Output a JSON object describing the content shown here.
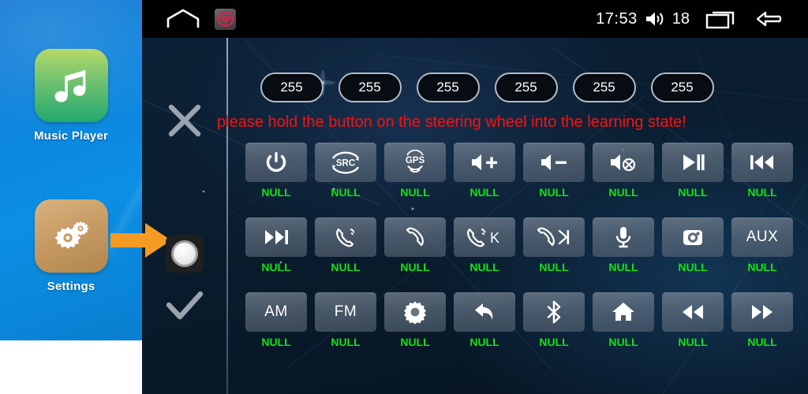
{
  "launcher": {
    "apps": [
      {
        "label": "Music Player",
        "icon": "music-note-icon"
      },
      {
        "label": "Settings",
        "icon": "gears-icon"
      }
    ],
    "pointer_icon": "orange-right-arrow-icon"
  },
  "statusbar": {
    "home_icon": "home-outline-icon",
    "steering_app_icon": "steering-wheel-icon",
    "time": "17:53",
    "volume_icon": "volume-speaker-icon",
    "volume_level": "18",
    "recents_icon": "recent-apps-icon",
    "back_icon": "back-arrow-icon"
  },
  "controls": {
    "cancel_icon": "close-x-icon",
    "knob_icon": "steering-knob-icon",
    "confirm_icon": "checkmark-icon"
  },
  "value_pills": [
    "255",
    "255",
    "255",
    "255",
    "255",
    "255"
  ],
  "warning": {
    "message": "please hold the button on the steering wheel into the learning state!",
    "color": "#f21414"
  },
  "grid": {
    "null_label": "NULL",
    "null_color": "#17e017",
    "buttons": [
      {
        "icon": "power-icon",
        "glyph": "",
        "status": "NULL"
      },
      {
        "icon": "src-source-icon",
        "glyph": "SRC",
        "status": "NULL"
      },
      {
        "icon": "gps-icon",
        "glyph": "GPS",
        "status": "NULL"
      },
      {
        "icon": "volume-up-icon",
        "glyph": "",
        "status": "NULL"
      },
      {
        "icon": "volume-down-icon",
        "glyph": "",
        "status": "NULL"
      },
      {
        "icon": "volume-mute-icon",
        "glyph": "",
        "status": "NULL"
      },
      {
        "icon": "play-pause-icon",
        "glyph": "",
        "status": "NULL"
      },
      {
        "icon": "previous-track-icon",
        "glyph": "",
        "status": "NULL"
      },
      {
        "icon": "next-track-icon",
        "glyph": "",
        "status": "NULL"
      },
      {
        "icon": "call-answer-icon",
        "glyph": "",
        "status": "NULL"
      },
      {
        "icon": "call-hangup-icon",
        "glyph": "",
        "status": "NULL"
      },
      {
        "icon": "call-answer-k-icon",
        "glyph": "K",
        "status": "NULL"
      },
      {
        "icon": "call-hangup-skip-icon",
        "glyph": "",
        "status": "NULL"
      },
      {
        "icon": "microphone-icon",
        "glyph": "",
        "status": "NULL"
      },
      {
        "icon": "camera-icon",
        "glyph": "",
        "status": "NULL"
      },
      {
        "icon": "aux-icon",
        "glyph": "AUX",
        "status": "NULL"
      },
      {
        "icon": "am-radio-icon",
        "glyph": "AM",
        "status": "NULL"
      },
      {
        "icon": "fm-radio-icon",
        "glyph": "FM",
        "status": "NULL"
      },
      {
        "icon": "brightness-sun-icon",
        "glyph": "",
        "status": "NULL"
      },
      {
        "icon": "back-return-icon",
        "glyph": "",
        "status": "NULL"
      },
      {
        "icon": "bluetooth-icon",
        "glyph": "",
        "status": "NULL"
      },
      {
        "icon": "home-icon",
        "glyph": "",
        "status": "NULL"
      },
      {
        "icon": "rewind-icon",
        "glyph": "",
        "status": "NULL"
      },
      {
        "icon": "fast-forward-icon",
        "glyph": "",
        "status": "NULL"
      }
    ]
  }
}
